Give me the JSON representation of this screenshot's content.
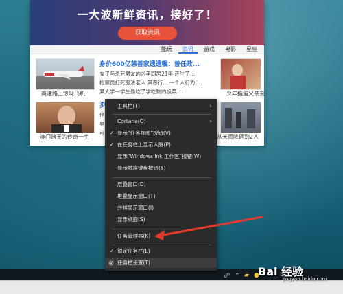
{
  "news_widget": {
    "banner_title": "一大波新鲜资讯，接好了！",
    "banner_button": "获取资讯",
    "tabs": [
      "酷玩",
      "资讯",
      "游戏",
      "电影",
      "星座"
    ],
    "active_tab_index": 1,
    "left_top_caption": "高速路上惊现飞机!",
    "left_bottom_caption": "澳门赌王的传奇一生",
    "headline": "身价600亿慈善家遗遗嘱：曾任政...",
    "snippets": [
      "女子与杀死男友的凶手同居21年 还生了...",
      "检察员打死服法老人 其恶行... 一个人行为(...",
      "某大学一学生偷吃了学吃剩的饭菜 ..."
    ],
    "headline2_partial": "步",
    "middle_partial_snippets": [
      "他",
      "男",
      "可"
    ],
    "right_top_caption": "少年指蛋父亲亲费费",
    "right_bottom_caption": "从天而降砸到2人"
  },
  "context_menu": {
    "items": [
      {
        "label": "工具栏(T)",
        "checked": false,
        "submenu": true
      },
      {
        "label": "Cortana(O)",
        "checked": false,
        "submenu": true
      },
      {
        "label": "显示\"任务视图\"按钮(V)",
        "checked": true,
        "submenu": false
      },
      {
        "label": "在任务栏上显示人脉(P)",
        "checked": true,
        "submenu": false
      },
      {
        "label": "显示\"Windows Ink 工作区\"按钮(W)",
        "checked": false,
        "submenu": false
      },
      {
        "label": "显示触摸键盘按钮(Y)",
        "checked": false,
        "submenu": false
      },
      {
        "label": "层叠窗口(D)",
        "checked": false,
        "submenu": false
      },
      {
        "label": "堆叠显示窗口(T)",
        "checked": false,
        "submenu": false
      },
      {
        "label": "并排显示窗口(I)",
        "checked": false,
        "submenu": false
      },
      {
        "label": "显示桌面(S)",
        "checked": false,
        "submenu": false
      },
      {
        "label": "任务管理器(K)",
        "checked": false,
        "submenu": false
      },
      {
        "label": "锁定任务栏(L)",
        "checked": true,
        "submenu": false
      },
      {
        "label": "任务栏设置(T)",
        "checked": false,
        "submenu": false,
        "icon": "gear-icon"
      }
    ],
    "check_glyph": "✓",
    "submenu_glyph": "›"
  },
  "annotation": {
    "color": "#e23a2e"
  },
  "watermark": {
    "text": "Bai 经验",
    "url": "jingyan.baidu.com"
  }
}
